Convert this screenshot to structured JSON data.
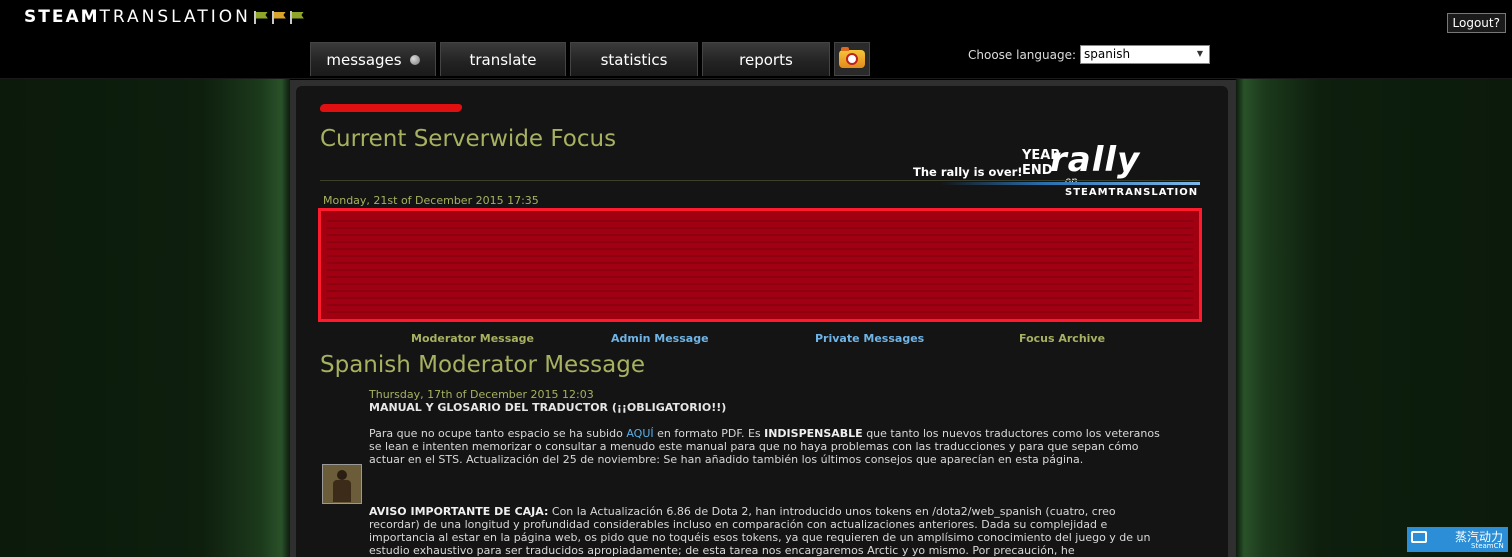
{
  "header": {
    "logo_bold": "STEAM",
    "logo_thin": "TRANSLATION",
    "logout_label": "Logout?",
    "nav": {
      "messages": "messages",
      "translate": "translate",
      "statistics": "statistics",
      "reports": "reports"
    },
    "language": {
      "label": "Choose language:",
      "selected": "spanish"
    }
  },
  "focus": {
    "title": "Current Serverwide Focus",
    "date": "Monday, 21st of December 2015 17:35",
    "rally": {
      "over_text": "The rally is over!",
      "year": "YEAR",
      "end": "END",
      "word": "rally",
      "on": "on",
      "brand": "STEAMTRANSLATION"
    }
  },
  "message_links": {
    "moderator": "Moderator Message",
    "admin": "Admin Message",
    "private": "Private Messages",
    "archive": "Focus Archive"
  },
  "moderator_message": {
    "title": "Spanish Moderator Message",
    "date": "Thursday, 17th of December 2015 12:03",
    "post_title": "MANUAL Y GLOSARIO DEL TRADUCTOR (¡¡OBLIGATORIO!!)",
    "p1_a": "Para que no ocupe tanto espacio se ha subido ",
    "p1_link": "AQUÍ",
    "p1_b": " en formato PDF. Es ",
    "p1_bold": "INDISPENSABLE",
    "p1_c": " que tanto los nuevos traductores como los veteranos se lean e intenten memorizar o consultar a menudo este manual para que no haya problemas con las traducciones y para que sepan cómo actuar en el STS. Actualización del 25 de noviembre: Se han añadido también los últimos consejos que aparecían en esta página.",
    "p2_bold": "AVISO IMPORTANTE DE CAJA:",
    "p2_text": " Con la Actualización 6.86 de Dota 2, han introducido unos tokens en /dota2/web_spanish (cuatro, creo recordar) de una longitud y profundidad considerables incluso en comparación con actualizaciones anteriores. Dada su complejidad e importancia al estar en la página web, os pido que no toquéis esos tokens, ya que requieren de un amplísimo conocimiento del juego y de un estudio exhaustivo para ser traducidos apropiadamente; de esta tarea nos encargaremos Arctic y yo mismo. Por precaución, he"
  },
  "watermark": {
    "cn": "蒸汽动力",
    "en": "SteamCN"
  }
}
